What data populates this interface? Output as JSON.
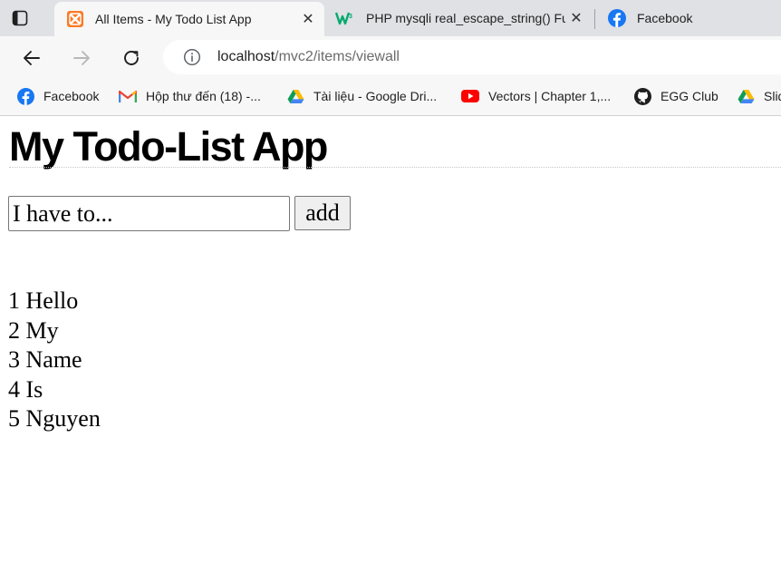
{
  "browser": {
    "tabs": [
      {
        "title": "All Items - My Todo List App",
        "active": true,
        "close": "✕"
      },
      {
        "title": "PHP mysqli real_escape_string() Function",
        "active": false,
        "close": "✕"
      },
      {
        "title": "Facebook",
        "active": false
      }
    ],
    "address": {
      "host": "localhost",
      "path": "/mvc2/items/viewall"
    },
    "bookmarks": [
      {
        "label": "Facebook",
        "icon": "facebook-icon"
      },
      {
        "label": "Hộp thư đến (18) -...",
        "icon": "gmail-icon"
      },
      {
        "label": "Tài liệu - Google Dri...",
        "icon": "google-drive-icon"
      },
      {
        "label": "Vectors | Chapter 1,...",
        "icon": "youtube-icon"
      },
      {
        "label": "EGG Club",
        "icon": "github-icon"
      },
      {
        "label": "Slides",
        "icon": "google-drive-icon"
      }
    ]
  },
  "app": {
    "title": "My Todo-List App",
    "input_placeholder": "I have to...",
    "add_label": "add",
    "items": [
      {
        "id": "1",
        "text": "Hello"
      },
      {
        "id": "2",
        "text": "My"
      },
      {
        "id": "3",
        "text": "Name"
      },
      {
        "id": "4",
        "text": "Is"
      },
      {
        "id": "5",
        "text": "Nguyen"
      }
    ]
  },
  "colors": {
    "tabstrip": "#dfe1e5",
    "toolbar": "#f7f7f7",
    "xampp": "#fb7a24",
    "facebook": "#1877f2",
    "youtube": "#ff0000",
    "w3": "#04aa6d"
  }
}
